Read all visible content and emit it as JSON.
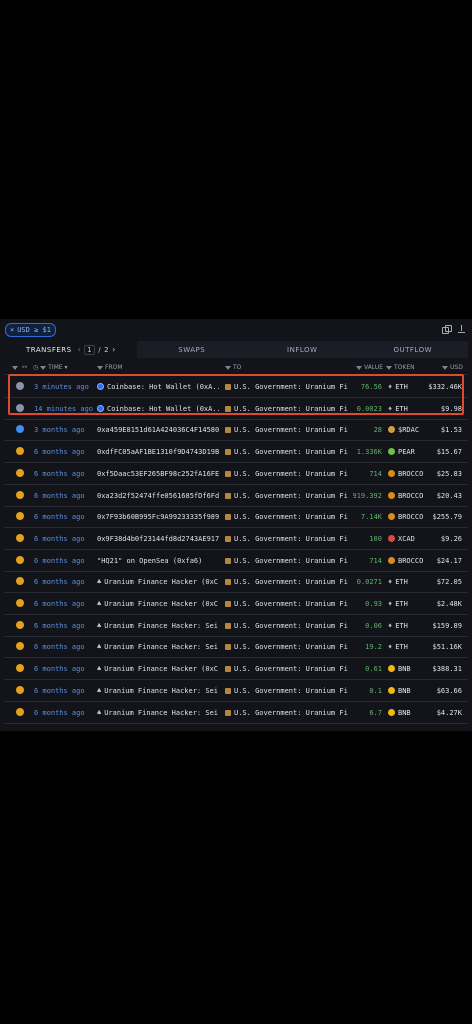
{
  "filter": {
    "text": "USD ≥ $1",
    "close": "×"
  },
  "tabs": {
    "transfers": "TRANSFERS",
    "page_current": "1",
    "page_sep": "/",
    "page_total": "2",
    "swaps": "SWAPS",
    "inflow": "INFLOW",
    "outflow": "OUTFLOW"
  },
  "columns": {
    "time": "TIME",
    "from": "FROM",
    "to": "TO",
    "value": "VALUE",
    "token": "TOKEN",
    "usd": "USD"
  },
  "colors": {
    "accent": "#2e6bd8",
    "highlight": "#e04a2c",
    "positive": "#5fb36b",
    "time": "#5d8fe0"
  },
  "rows": [
    {
      "time": "3 minutes ago",
      "from": "Coinbase: Hot Wallet (0xA...",
      "to": "U.S. Government: Uranium Fi...",
      "value": "76.56",
      "token": "ETH",
      "usd": "$332.46K"
    },
    {
      "time": "14 minutes ago",
      "from": "Coinbase: Hot Wallet (0xA...",
      "to": "U.S. Government: Uranium Fi...",
      "value": "0.0023",
      "token": "ETH",
      "usd": "$9.98"
    },
    {
      "time": "3 months ago",
      "from": "0xa459E8151d61A424036C4F14580...",
      "to": "U.S. Government: Uranium Fi...",
      "value": "28",
      "token": "$RDAC",
      "usd": "$1.53"
    },
    {
      "time": "6 months ago",
      "from": "0xdfFC05aAF1BE1310f9D4743D19B...",
      "to": "U.S. Government: Uranium Fi...",
      "value": "1.336K",
      "token": "PEAR",
      "usd": "$15.67"
    },
    {
      "time": "6 months ago",
      "from": "0xf5Daac53EF265BF98c252fA16FE...",
      "to": "U.S. Government: Uranium Fi...",
      "value": "714",
      "token": "BROCCO",
      "usd": "$25.83"
    },
    {
      "time": "6 months ago",
      "from": "0xa23d2f52474ffe0561685fDf6Fd...",
      "to": "U.S. Government: Uranium Fi...",
      "value": "919.392",
      "token": "BROCCO",
      "usd": "$20.43"
    },
    {
      "time": "6 months ago",
      "from": "0x7F93b60B995Fc9A99233335f989...",
      "to": "U.S. Government: Uranium Fi...",
      "value": "7.14K",
      "token": "BROCCO",
      "usd": "$255.79"
    },
    {
      "time": "6 months ago",
      "from": "0x9F38d4b0f23144fd8d2743AE917...",
      "to": "U.S. Government: Uranium Fi...",
      "value": "100",
      "token": "XCAD",
      "usd": "$9.26"
    },
    {
      "time": "6 months ago",
      "from": "\"HQ21\" on OpenSea (0xfa6)",
      "to": "U.S. Government: Uranium Fi...",
      "value": "714",
      "token": "BROCCO",
      "usd": "$24.17"
    },
    {
      "time": "6 months ago",
      "from": "Uranium Finance Hacker (0xC...",
      "to": "U.S. Government: Uranium Fi...",
      "value": "0.0271",
      "token": "ETH",
      "usd": "$72.05"
    },
    {
      "time": "6 months ago",
      "from": "Uranium Finance Hacker (0xC...",
      "to": "U.S. Government: Uranium Fi...",
      "value": "0.93",
      "token": "ETH",
      "usd": "$2.48K"
    },
    {
      "time": "6 months ago",
      "from": "Uranium Finance Hacker: Sei...",
      "to": "U.S. Government: Uranium Fi...",
      "value": "0.06",
      "token": "ETH",
      "usd": "$159.89"
    },
    {
      "time": "6 months ago",
      "from": "Uranium Finance Hacker: Sei...",
      "to": "U.S. Government: Uranium Fi...",
      "value": "19.2",
      "token": "ETH",
      "usd": "$51.16K"
    },
    {
      "time": "6 months ago",
      "from": "Uranium Finance Hacker (0xC...",
      "to": "U.S. Government: Uranium Fi...",
      "value": "0.61",
      "token": "BNB",
      "usd": "$388.31"
    },
    {
      "time": "6 months ago",
      "from": "Uranium Finance Hacker: Sei...",
      "to": "U.S. Government: Uranium Fi...",
      "value": "0.1",
      "token": "BNB",
      "usd": "$63.66"
    },
    {
      "time": "6 months ago",
      "from": "Uranium Finance Hacker: Sei...",
      "to": "U.S. Government: Uranium Fi...",
      "value": "6.7",
      "token": "BNB",
      "usd": "$4.27K"
    }
  ]
}
